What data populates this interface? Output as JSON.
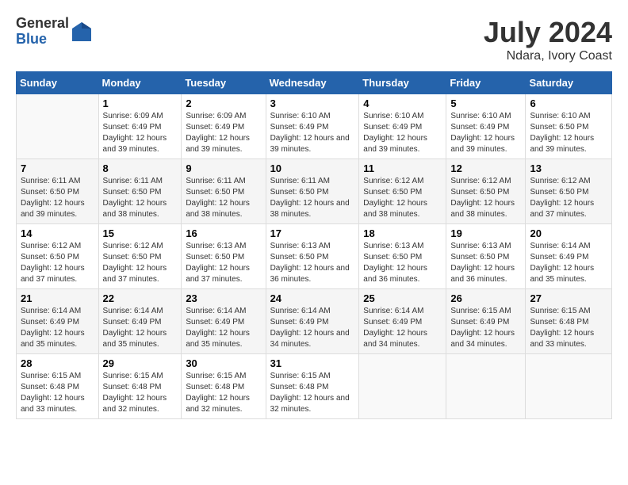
{
  "logo": {
    "general": "General",
    "blue": "Blue"
  },
  "title": "July 2024",
  "subtitle": "Ndara, Ivory Coast",
  "days_header": [
    "Sunday",
    "Monday",
    "Tuesday",
    "Wednesday",
    "Thursday",
    "Friday",
    "Saturday"
  ],
  "weeks": [
    [
      {
        "day": "",
        "sunrise": "",
        "sunset": "",
        "daylight": ""
      },
      {
        "day": "1",
        "sunrise": "Sunrise: 6:09 AM",
        "sunset": "Sunset: 6:49 PM",
        "daylight": "Daylight: 12 hours and 39 minutes."
      },
      {
        "day": "2",
        "sunrise": "Sunrise: 6:09 AM",
        "sunset": "Sunset: 6:49 PM",
        "daylight": "Daylight: 12 hours and 39 minutes."
      },
      {
        "day": "3",
        "sunrise": "Sunrise: 6:10 AM",
        "sunset": "Sunset: 6:49 PM",
        "daylight": "Daylight: 12 hours and 39 minutes."
      },
      {
        "day": "4",
        "sunrise": "Sunrise: 6:10 AM",
        "sunset": "Sunset: 6:49 PM",
        "daylight": "Daylight: 12 hours and 39 minutes."
      },
      {
        "day": "5",
        "sunrise": "Sunrise: 6:10 AM",
        "sunset": "Sunset: 6:49 PM",
        "daylight": "Daylight: 12 hours and 39 minutes."
      },
      {
        "day": "6",
        "sunrise": "Sunrise: 6:10 AM",
        "sunset": "Sunset: 6:50 PM",
        "daylight": "Daylight: 12 hours and 39 minutes."
      }
    ],
    [
      {
        "day": "7",
        "sunrise": "Sunrise: 6:11 AM",
        "sunset": "Sunset: 6:50 PM",
        "daylight": "Daylight: 12 hours and 39 minutes."
      },
      {
        "day": "8",
        "sunrise": "Sunrise: 6:11 AM",
        "sunset": "Sunset: 6:50 PM",
        "daylight": "Daylight: 12 hours and 38 minutes."
      },
      {
        "day": "9",
        "sunrise": "Sunrise: 6:11 AM",
        "sunset": "Sunset: 6:50 PM",
        "daylight": "Daylight: 12 hours and 38 minutes."
      },
      {
        "day": "10",
        "sunrise": "Sunrise: 6:11 AM",
        "sunset": "Sunset: 6:50 PM",
        "daylight": "Daylight: 12 hours and 38 minutes."
      },
      {
        "day": "11",
        "sunrise": "Sunrise: 6:12 AM",
        "sunset": "Sunset: 6:50 PM",
        "daylight": "Daylight: 12 hours and 38 minutes."
      },
      {
        "day": "12",
        "sunrise": "Sunrise: 6:12 AM",
        "sunset": "Sunset: 6:50 PM",
        "daylight": "Daylight: 12 hours and 38 minutes."
      },
      {
        "day": "13",
        "sunrise": "Sunrise: 6:12 AM",
        "sunset": "Sunset: 6:50 PM",
        "daylight": "Daylight: 12 hours and 37 minutes."
      }
    ],
    [
      {
        "day": "14",
        "sunrise": "Sunrise: 6:12 AM",
        "sunset": "Sunset: 6:50 PM",
        "daylight": "Daylight: 12 hours and 37 minutes."
      },
      {
        "day": "15",
        "sunrise": "Sunrise: 6:12 AM",
        "sunset": "Sunset: 6:50 PM",
        "daylight": "Daylight: 12 hours and 37 minutes."
      },
      {
        "day": "16",
        "sunrise": "Sunrise: 6:13 AM",
        "sunset": "Sunset: 6:50 PM",
        "daylight": "Daylight: 12 hours and 37 minutes."
      },
      {
        "day": "17",
        "sunrise": "Sunrise: 6:13 AM",
        "sunset": "Sunset: 6:50 PM",
        "daylight": "Daylight: 12 hours and 36 minutes."
      },
      {
        "day": "18",
        "sunrise": "Sunrise: 6:13 AM",
        "sunset": "Sunset: 6:50 PM",
        "daylight": "Daylight: 12 hours and 36 minutes."
      },
      {
        "day": "19",
        "sunrise": "Sunrise: 6:13 AM",
        "sunset": "Sunset: 6:50 PM",
        "daylight": "Daylight: 12 hours and 36 minutes."
      },
      {
        "day": "20",
        "sunrise": "Sunrise: 6:14 AM",
        "sunset": "Sunset: 6:49 PM",
        "daylight": "Daylight: 12 hours and 35 minutes."
      }
    ],
    [
      {
        "day": "21",
        "sunrise": "Sunrise: 6:14 AM",
        "sunset": "Sunset: 6:49 PM",
        "daylight": "Daylight: 12 hours and 35 minutes."
      },
      {
        "day": "22",
        "sunrise": "Sunrise: 6:14 AM",
        "sunset": "Sunset: 6:49 PM",
        "daylight": "Daylight: 12 hours and 35 minutes."
      },
      {
        "day": "23",
        "sunrise": "Sunrise: 6:14 AM",
        "sunset": "Sunset: 6:49 PM",
        "daylight": "Daylight: 12 hours and 35 minutes."
      },
      {
        "day": "24",
        "sunrise": "Sunrise: 6:14 AM",
        "sunset": "Sunset: 6:49 PM",
        "daylight": "Daylight: 12 hours and 34 minutes."
      },
      {
        "day": "25",
        "sunrise": "Sunrise: 6:14 AM",
        "sunset": "Sunset: 6:49 PM",
        "daylight": "Daylight: 12 hours and 34 minutes."
      },
      {
        "day": "26",
        "sunrise": "Sunrise: 6:15 AM",
        "sunset": "Sunset: 6:49 PM",
        "daylight": "Daylight: 12 hours and 34 minutes."
      },
      {
        "day": "27",
        "sunrise": "Sunrise: 6:15 AM",
        "sunset": "Sunset: 6:48 PM",
        "daylight": "Daylight: 12 hours and 33 minutes."
      }
    ],
    [
      {
        "day": "28",
        "sunrise": "Sunrise: 6:15 AM",
        "sunset": "Sunset: 6:48 PM",
        "daylight": "Daylight: 12 hours and 33 minutes."
      },
      {
        "day": "29",
        "sunrise": "Sunrise: 6:15 AM",
        "sunset": "Sunset: 6:48 PM",
        "daylight": "Daylight: 12 hours and 32 minutes."
      },
      {
        "day": "30",
        "sunrise": "Sunrise: 6:15 AM",
        "sunset": "Sunset: 6:48 PM",
        "daylight": "Daylight: 12 hours and 32 minutes."
      },
      {
        "day": "31",
        "sunrise": "Sunrise: 6:15 AM",
        "sunset": "Sunset: 6:48 PM",
        "daylight": "Daylight: 12 hours and 32 minutes."
      },
      {
        "day": "",
        "sunrise": "",
        "sunset": "",
        "daylight": ""
      },
      {
        "day": "",
        "sunrise": "",
        "sunset": "",
        "daylight": ""
      },
      {
        "day": "",
        "sunrise": "",
        "sunset": "",
        "daylight": ""
      }
    ]
  ]
}
